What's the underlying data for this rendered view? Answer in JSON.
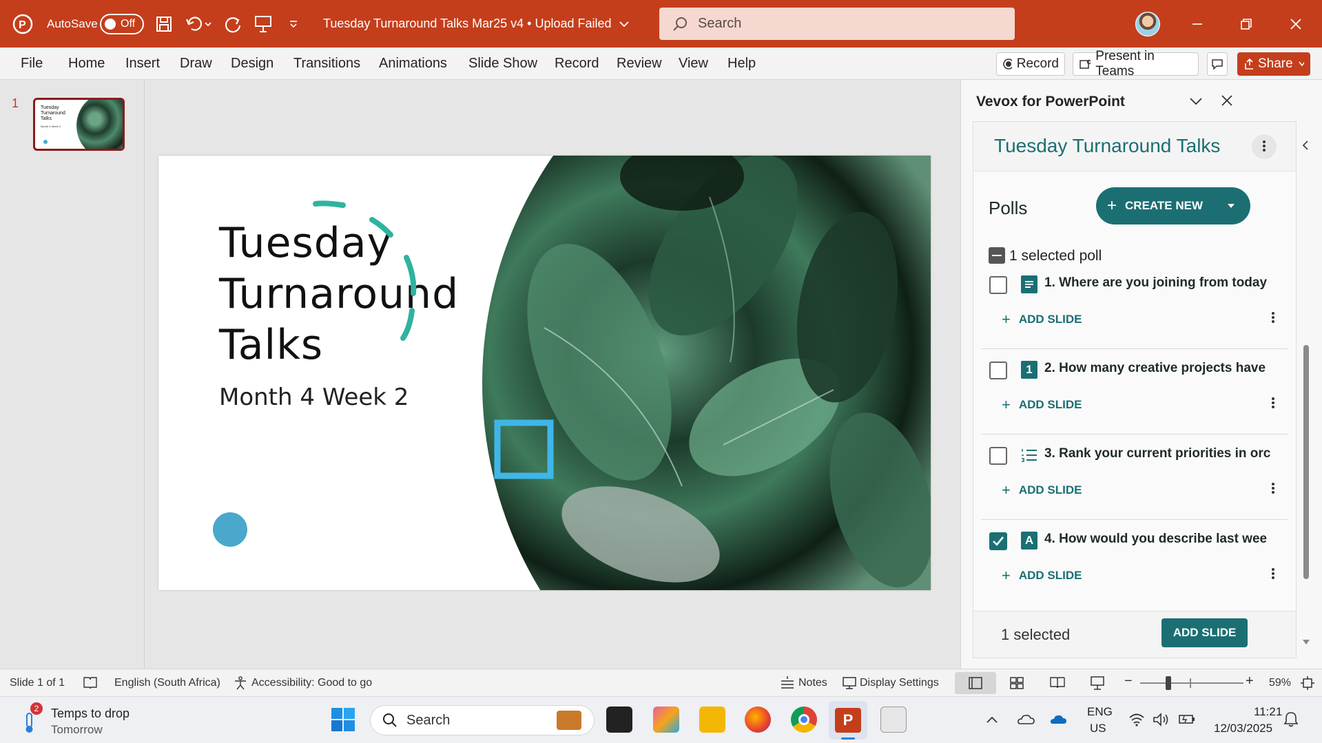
{
  "titlebar": {
    "autosave_label": "AutoSave",
    "autosave_state": "Off",
    "doc_title": "Tuesday Turnaround Talks Mar25 v4 • Upload Failed",
    "search_placeholder": "Search",
    "brand_color": "#c43e1c"
  },
  "ribbon": {
    "tabs": [
      "File",
      "Home",
      "Insert",
      "Draw",
      "Design",
      "Transitions",
      "Animations",
      "Slide Show",
      "Record",
      "Review",
      "View",
      "Help"
    ],
    "record_label": "Record",
    "present_teams_label": "Present in Teams",
    "share_label": "Share"
  },
  "thumbnails": {
    "slide_number": "1",
    "thumb_title": "Tuesday Turnaround Talks",
    "thumb_sub": "Month 4 Week 2"
  },
  "slide": {
    "title_lines": [
      "Tuesday",
      "Turnaround",
      "Talks"
    ],
    "subtitle": "Month 4 Week 2",
    "accent_teal": "#2fb3a0",
    "accent_blue": "#3fb6e8",
    "dot_color": "#4aa8cc"
  },
  "vevox": {
    "panel_title": "Vevox for PowerPoint",
    "session_title": "Tuesday Turnaround Talks",
    "section_title": "Polls",
    "create_label": "CREATE NEW",
    "selected_summary": "1 selected poll",
    "polls": [
      {
        "title": "1. Where are you joining from today",
        "type_icon": "text-icon",
        "checked": false,
        "add_label": "ADD SLIDE"
      },
      {
        "title": "2. How many creative projects have",
        "type_icon": "number-icon",
        "checked": false,
        "add_label": "ADD SLIDE"
      },
      {
        "title": "3. Rank your current priorities in orc",
        "type_icon": "ranking-icon",
        "checked": false,
        "add_label": "ADD SLIDE"
      },
      {
        "title": "4. How would you describe last wee",
        "type_icon": "word-icon",
        "checked": true,
        "add_label": "ADD SLIDE"
      }
    ],
    "footer_selected": "1 selected",
    "footer_button": "ADD SLIDE",
    "teal": "#1b6f73"
  },
  "statusbar": {
    "slide_info": "Slide 1 of 1",
    "language": "English (South Africa)",
    "accessibility": "Accessibility: Good to go",
    "notes": "Notes",
    "display_settings": "Display Settings",
    "zoom": "59%"
  },
  "taskbar": {
    "weather_title": "Temps to drop",
    "weather_sub": "Tomorrow",
    "weather_badge": "2",
    "search_label": "Search",
    "lang_top": "ENG",
    "lang_bottom": "US",
    "time": "11:21",
    "date": "12/03/2025"
  }
}
